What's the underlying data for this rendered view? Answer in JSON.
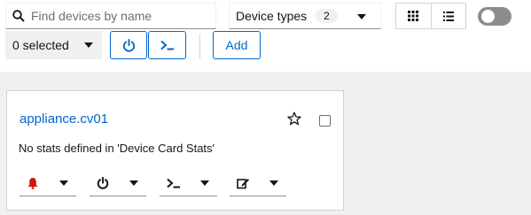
{
  "search": {
    "placeholder": "Find devices by name",
    "value": ""
  },
  "device_types": {
    "label": "Device types",
    "count": "2"
  },
  "view": {
    "active": "grid"
  },
  "bulk": {
    "selected_label": "0 selected"
  },
  "actions": {
    "add_label": "Add"
  },
  "card": {
    "title": "appliance.cv01",
    "message": "No stats defined in 'Device Card Stats'",
    "alert_color": "#c9190b"
  },
  "colors": {
    "accent": "#0066cc",
    "background": "#f0f0f0"
  }
}
